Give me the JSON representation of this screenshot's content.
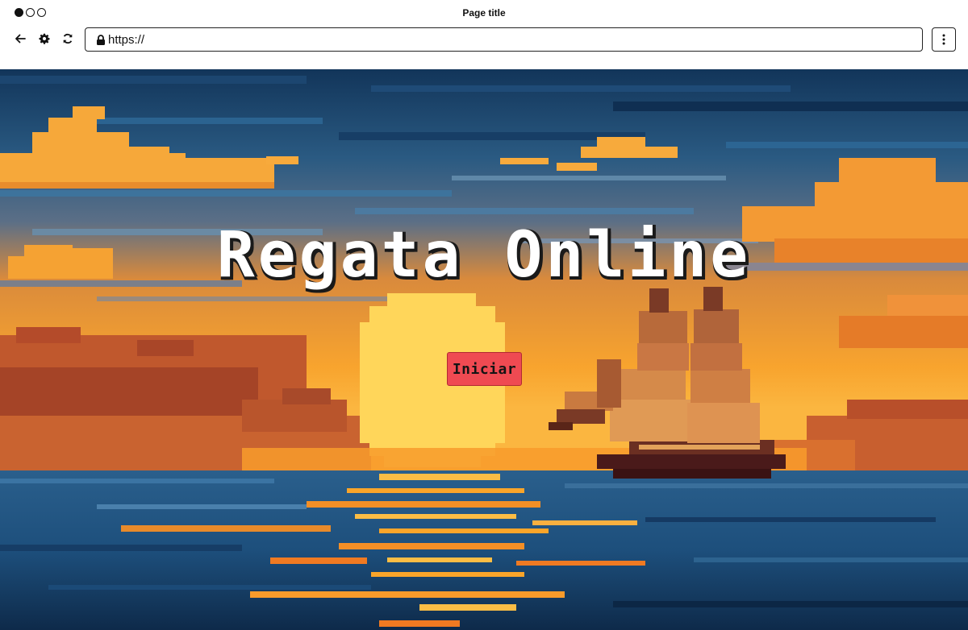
{
  "browser": {
    "window_title": "Page title",
    "url": "https://",
    "icons": {
      "back": "arrow-left-icon",
      "settings": "gear-icon",
      "reload": "reload-icon",
      "lock": "lock-icon",
      "menu": "kebab-menu-icon"
    }
  },
  "game": {
    "title": "Regata Online",
    "start_label": "Iniciar",
    "colors": {
      "button": "#ef4a52",
      "title_text": "#ffffff",
      "title_shadow": "#1a1a1a",
      "sky_top": "#12355a",
      "sun": "#ffd65a",
      "sea": "#1d4f7c"
    },
    "scene": "pixel-art sunset over sea with sailing ship"
  }
}
